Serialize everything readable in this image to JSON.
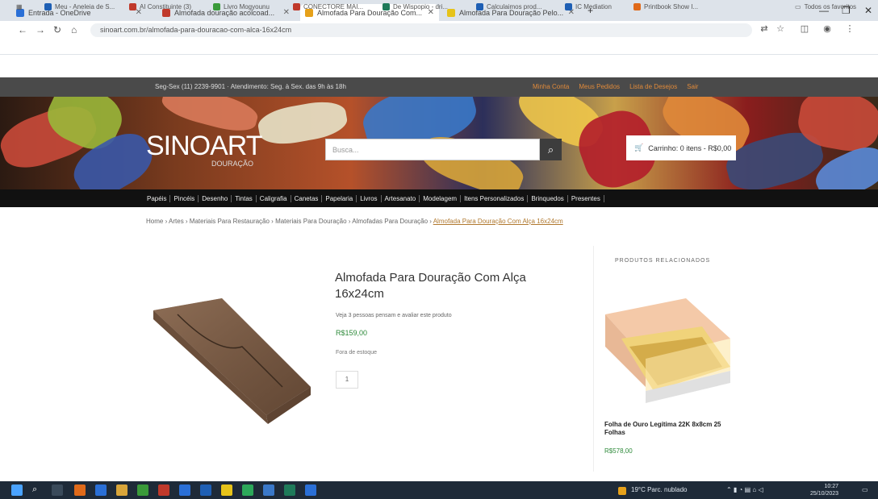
{
  "browser": {
    "tabs": [
      {
        "label": "Entrada - OneDrive",
        "color": "#2a6fd6"
      },
      {
        "label": "Almofada douração acolcoad...",
        "color": "#c0392b"
      },
      {
        "label": "Almofada Para Douração Com...",
        "color": "#e6a11a"
      },
      {
        "label": "Almofada Para Douração Pelo...",
        "color": "#e6c31a"
      }
    ],
    "new_tab": "+",
    "url": "sinoart.com.br/almofada-para-douracao-com-alca-16x24cm",
    "bookmarks": [
      {
        "label": "Meu - Aneleia de S...",
        "color": "#1e5fb4"
      },
      {
        "label": "AI Constituinte (3)",
        "color": "#c0392b"
      },
      {
        "label": "Livro Mogyounu",
        "color": "#3a9a3a"
      },
      {
        "label": "CONECTORE MAI...",
        "color": "#c0392b"
      },
      {
        "label": "De Wispopio - dri...",
        "color": "#1e7a5a"
      },
      {
        "label": "Calculaimos prod...",
        "color": "#1e5fb4"
      },
      {
        "label": "IC Mediation",
        "color": "#1e5fb4"
      },
      {
        "label": "Printbook Show I...",
        "color": "#e06a1a"
      }
    ],
    "all_bookmarks": "Todos os favoritos"
  },
  "site": {
    "topbar_info": "Seg-Sex (11) 2239-9901 · Atendimento: Seg. à Sex. das 9h às 18h",
    "topbar_links": [
      "Minha Conta",
      "Meus Pedidos",
      "Lista de Desejos",
      "Sair"
    ],
    "logo": "SINOART",
    "logo_sub": "DOURAÇÃO",
    "search_placeholder": "Busca...",
    "cart_label": "Carrinho: 0 itens - R$0,00",
    "nav": [
      "Papéis",
      "Pincéis",
      "Desenho",
      "Tintas",
      "Caligrafia",
      "Canetas",
      "Papelaria",
      "Livros",
      "Artesanato",
      "Modelagem",
      "Itens Personalizados",
      "Brinquedos",
      "Presentes"
    ],
    "breadcrumb": [
      "Home",
      "Artes",
      "Materiais Para Restauração",
      "Materiais Para Douração",
      "Almofadas Para Douração"
    ],
    "breadcrumb_current": "Almofada Para Douração Com Alça 16x24cm",
    "product": {
      "title": "Almofada Para Douração Com Alça 16x24cm",
      "note": "Veja 3 pessoas pensam e avaliar este produto",
      "price": "R$159,00",
      "stock": "Fora de estoque",
      "qty": "1"
    },
    "related": {
      "heading": "PRODUTOS RELACIONADOS",
      "name": "Folha de Ouro Legítima 22K 8x8cm 25 Folhas",
      "price": "R$578,00"
    }
  },
  "taskbar": {
    "weather": "19°C Parc. nublado",
    "time": "10:27",
    "date": "25/10/2023"
  }
}
